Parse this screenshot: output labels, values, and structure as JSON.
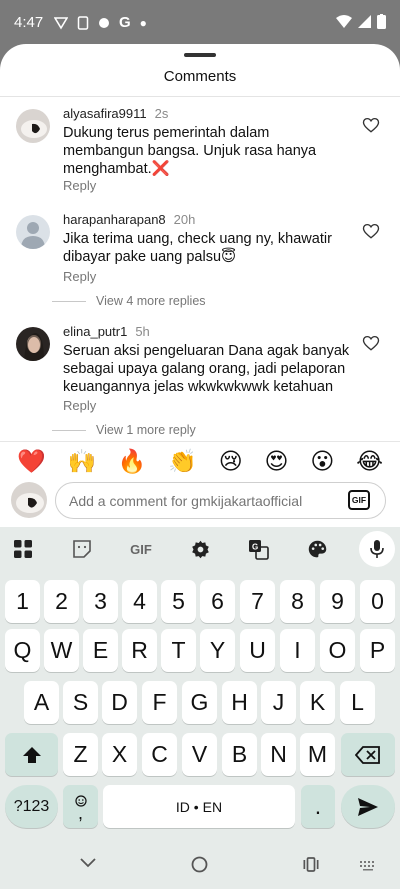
{
  "status": {
    "time": "4:47"
  },
  "sheet": {
    "title": "Comments"
  },
  "comments": [
    {
      "user": "alyasafira9911",
      "time": "2s",
      "text": "Dukung terus pemerintah dalam membangun bangsa. Unjuk rasa hanya menghambat.❌",
      "reply": "Reply"
    },
    {
      "user": "harapanharapan8",
      "time": "20h",
      "text": "Jika terima uang, check uang ny, khawatir dibayar pake uang palsu😇",
      "reply": "Reply",
      "more_replies": "View 4 more replies"
    },
    {
      "user": "elina_putr1",
      "time": "5h",
      "text": "Seruan aksi pengeluaran Dana agak banyak sebagai upaya galang orang, jadi pelaporan keuangannya jelas wkwkwkwwk ketahuan",
      "reply": "Reply",
      "more_replies": "View 1 more reply"
    }
  ],
  "emojis": [
    "❤️",
    "🙌",
    "🔥",
    "👏",
    "😢",
    "😍",
    "😮",
    "😂"
  ],
  "composer": {
    "placeholder": "Add a comment for gmkijakartaofficial",
    "gif_label": "GIF"
  },
  "keyboard": {
    "toolbar_gif": "GIF",
    "row_numbers": [
      "1",
      "2",
      "3",
      "4",
      "5",
      "6",
      "7",
      "8",
      "9",
      "0"
    ],
    "row1": [
      "Q",
      "W",
      "E",
      "R",
      "T",
      "Y",
      "U",
      "I",
      "O",
      "P"
    ],
    "row2": [
      "A",
      "S",
      "D",
      "F",
      "G",
      "H",
      "J",
      "K",
      "L"
    ],
    "row3": [
      "Z",
      "X",
      "C",
      "V",
      "B",
      "N",
      "M"
    ],
    "sym_label": "?123",
    "emoji_comma": ",",
    "space_label": "ID • EN",
    "period": "."
  }
}
